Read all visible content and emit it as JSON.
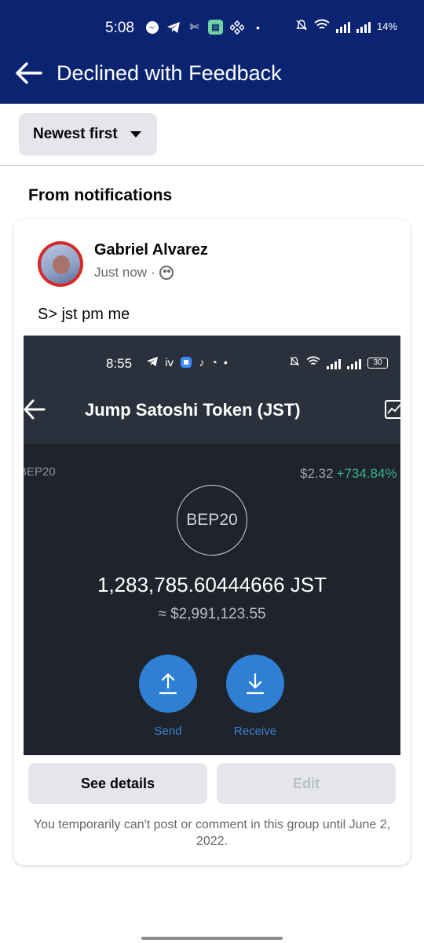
{
  "status_bar": {
    "time": "5:08",
    "battery": "14%"
  },
  "header": {
    "title": "Declined with Feedback",
    "background": "#0a2472"
  },
  "sort": {
    "label": "Newest first"
  },
  "section": {
    "title": "From notifications"
  },
  "post": {
    "author": "Gabriel Alvarez",
    "time": "Just now",
    "separator": "·",
    "text": "S> jst pm me",
    "screenshot": {
      "time": "8:55",
      "battery": "30",
      "title": "Jump Satoshi Token (JST)",
      "network": "BEP20",
      "price": "$2.32",
      "change": "+734.84%",
      "logo_text": "BEP20",
      "amount": "1,283,785.60444666 JST",
      "fiat": "≈ $2,991,123.55",
      "send_label": "Send",
      "receive_label": "Receive"
    }
  },
  "actions": {
    "details_label": "See details",
    "edit_label": "Edit"
  },
  "notice": "You temporarily can't post or comment in this group until June 2, 2022."
}
